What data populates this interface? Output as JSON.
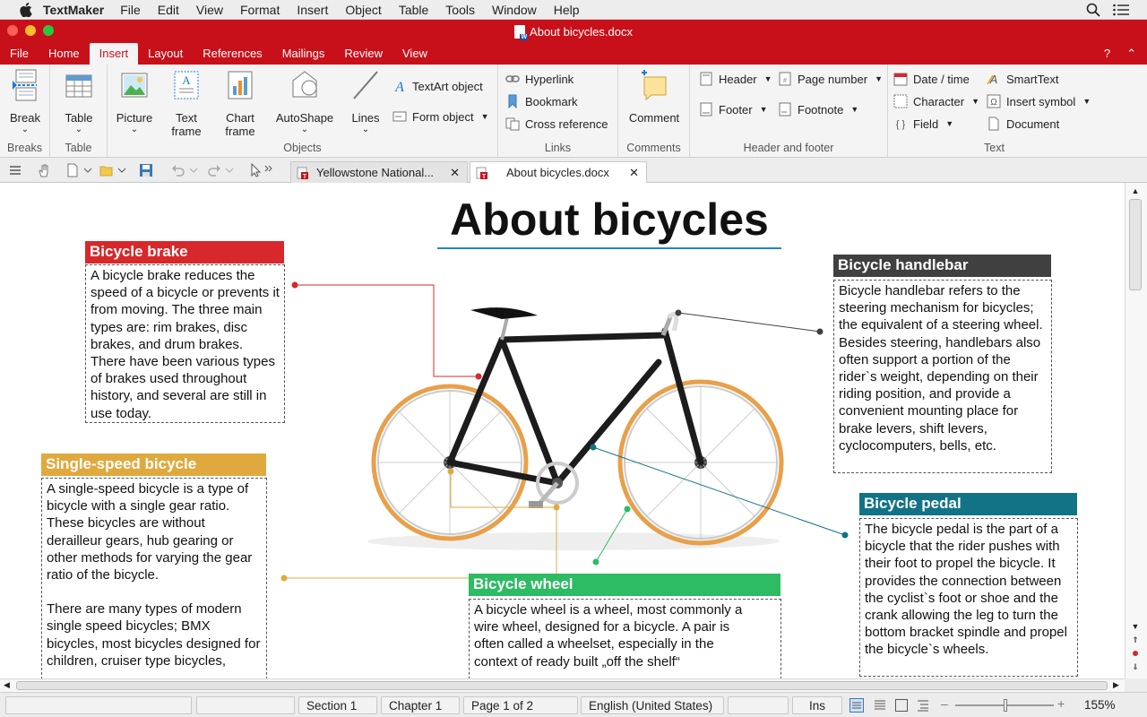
{
  "menubar": {
    "app": "TextMaker",
    "items": [
      "File",
      "Edit",
      "View",
      "Format",
      "Insert",
      "Object",
      "Table",
      "Tools",
      "Window",
      "Help"
    ]
  },
  "window": {
    "title": "About bicycles.docx"
  },
  "ribbon_tabs": [
    "File",
    "Home",
    "Insert",
    "Layout",
    "References",
    "Mailings",
    "Review",
    "View"
  ],
  "ribbon": {
    "breaks": {
      "break": "Break",
      "group": "Breaks"
    },
    "table": {
      "table": "Table",
      "group": "Table"
    },
    "objects": {
      "picture": "Picture",
      "text_frame": "Text frame",
      "chart_frame": "Chart frame",
      "autoshape": "AutoShape",
      "lines": "Lines",
      "textart": "TextArt object",
      "form_object": "Form object",
      "group": "Objects"
    },
    "links": {
      "hyperlink": "Hyperlink",
      "bookmark": "Bookmark",
      "cross_reference": "Cross reference",
      "group": "Links"
    },
    "comments": {
      "comment": "Comment",
      "group": "Comments"
    },
    "header_footer": {
      "header": "Header",
      "footer": "Footer",
      "page_number": "Page number",
      "footnote": "Footnote",
      "group": "Header and footer"
    },
    "text": {
      "date_time": "Date / time",
      "character": "Character",
      "field": "Field",
      "smarttext": "SmartText",
      "insert_symbol": "Insert symbol",
      "document": "Document",
      "group": "Text"
    }
  },
  "doc_tabs": [
    {
      "label": "Yellowstone National...",
      "active": false
    },
    {
      "label": "About bicycles.docx",
      "active": true
    }
  ],
  "document": {
    "title": "About bicycles",
    "brake": {
      "heading": "Bicycle brake",
      "text": "A bicycle brake reduces the speed of a bicycle or prevents it from moving. The three main types are: rim brakes, disc brakes, and drum brakes. There have been various types of brakes used throughout history, and several are still in use today."
    },
    "handlebar": {
      "heading": "Bicycle handlebar",
      "text": "Bicycle handlebar refers to the steering mechanism for bicycles; the equivalent of a steering wheel. Besides steering, handlebars also often support a portion of the rider`s weight, depending on their riding position, and provide a convenient mounting place for brake levers, shift levers, cyclocomputers, bells, etc."
    },
    "single_speed": {
      "heading": "Single-speed bicycle",
      "text1": "A single-speed bicycle is a type of bicycle with a single gear ratio. These bicycles are without derailleur gears, hub gearing or other methods for varying the gear ratio of the bicycle.",
      "text2": "There are many types of modern single speed bicycles; BMX bicycles, most bicycles designed for children, cruiser type bicycles,"
    },
    "pedal": {
      "heading": "Bicycle pedal",
      "text": "The bicycle pedal is the part of a bicycle that the rider pushes with their foot to propel the bicycle. It provides the connection between the cyclist`s foot or shoe and the crank allowing the leg to turn the bottom bracket spindle and propel the bicycle`s wheels."
    },
    "wheel": {
      "heading": "Bicycle wheel",
      "text": "A bicycle wheel is a wheel, most commonly a wire wheel, designed for a bicycle. A pair is often called a wheelset, especially in the context of ready built „off the shelf“"
    }
  },
  "colors": {
    "brand": "#c8101a",
    "brake": "#d7282b",
    "handlebar": "#404040",
    "single_speed": "#e0a93e",
    "pedal": "#127386",
    "wheel": "#2dbb63"
  },
  "statusbar": {
    "section": "Section 1",
    "chapter": "Chapter 1",
    "page": "Page 1 of 2",
    "language": "English (United States)",
    "mode": "Ins",
    "zoom": "155%"
  }
}
